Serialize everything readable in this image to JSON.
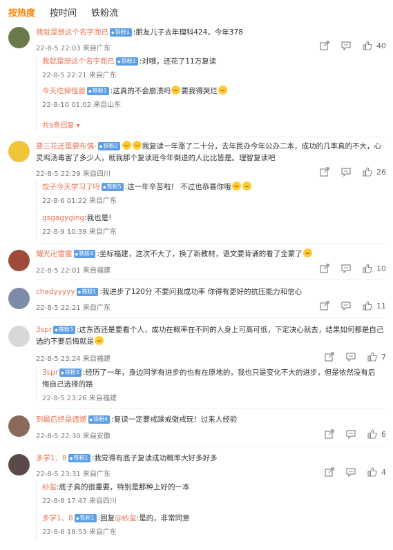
{
  "tabs": [
    "按热度",
    "按时间",
    "铁粉流"
  ],
  "comments": [
    {
      "user": "我就是想这个名字而已",
      "badge": "铁粉1",
      "text": ":朋友儿子去年理科424，今年378",
      "time": "22-8-5 22:03 来自广东",
      "likes": "40",
      "avatar_color": "#6b7a4a",
      "replies": [
        {
          "user": "我就是想这个名字而已",
          "badge": "铁粉1",
          "text": ":对哦，还花了11万复读",
          "time": "22-8-5 22:21 来自广东"
        },
        {
          "user": "今天吃掉怪兽",
          "badge": "铁粉1",
          "text": ":这真的不会崩溃吗",
          "tail": "要我得哭烂",
          "time": "22-8-10 01:02 来自山东"
        }
      ],
      "more": "共9条回复"
    },
    {
      "user": "要三花还是要布偶-",
      "badge": "铁粉2",
      "text": "我复读一年涨了二十分，去年民办今年公办二本，成功的几率真的不大，心灵鸡汤毒害了多少人，就我那个复读班今年倒退的人比比皆是。理智复读吧",
      "time": "22-8-5 22:29 来自四川",
      "likes": "26",
      "avatar_color": "#f2c43a",
      "replies": [
        {
          "user": "饺子今天学习了吗",
          "badge": "铁粉5",
          "text": ":这一年辛苦啦！  不过也恭喜你哦",
          "time": "22-8-6 01:22 来自广东"
        },
        {
          "user": "gsgagyging",
          "badge": "",
          "text": ":我也是!",
          "time": "22-8-9 10:39 来自广东"
        }
      ]
    },
    {
      "user": "耀光卍雷霆",
      "badge": "铁粉4",
      "text": ":坐标福建，这次不大了，换了新教材，语文要背诵的看了全蒙了",
      "time": "22-8-5 22:01 来自福建",
      "likes": "10",
      "avatar_color": "#a04a3a"
    },
    {
      "user": "chadyyyyy",
      "badge": "铁粉1",
      "text": ":我进步了120分 不要问我成功率 你得有更好的抗压能力和信心",
      "time": "22-8-5 22:21 来自广东",
      "likes": "11",
      "avatar_color": "#7d8aa8"
    },
    {
      "user": "3spr",
      "badge": "铁粉3",
      "text": ":这东西还是要看个人，成功在概率在不同的人身上可高可低，下定决心就去，结果如何都是自己选的不要后悔就是",
      "time": "22-8-5 23:24 来自福建",
      "likes": "7",
      "avatar_color": "#d8d8d8",
      "replies": [
        {
          "user": "3spr",
          "badge": "铁粉3",
          "text": ":经历了一年，身边同学有进步的也有在原地的，我也只是变化不大的进步，但是依然没有后悔自己选择的路",
          "time": "22-8-5 23:26 来自福建"
        }
      ]
    },
    {
      "user": "到最后终是遗憾",
      "badge": "铁粉4",
      "text": ":复读一定要戒躁戒傲戒玩！过来人经验",
      "time": "22-8-5 22:30 来自安徽",
      "likes": "6",
      "avatar_color": "#8a6a5a"
    },
    {
      "user": "多学1、8",
      "badge": "铁粉1",
      "text": ":我觉得有底子复读成功概率大好多好多",
      "time": "22-8-5 23:31 来自广东",
      "likes": "4",
      "avatar_color": "#5a4a4a",
      "replies": [
        {
          "user": "纱玺",
          "badge": "",
          "text": ":底子真的很重要，特别是那种上好的一本",
          "time": "22-8-8 17:47 来自四川"
        },
        {
          "user": "多学1、8",
          "badge": "铁粉1",
          "text": ":回复",
          "mention": "@纱玺",
          "text2": ":是的，非常同意",
          "time": "22-8-8 18:53 来自广东"
        }
      ]
    }
  ]
}
